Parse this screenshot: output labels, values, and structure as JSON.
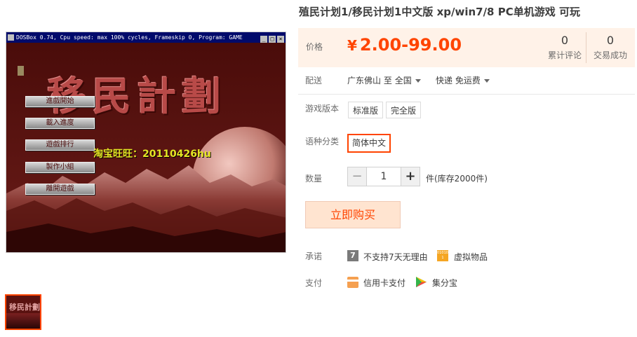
{
  "product": {
    "title": "殖民计划1/移民计划1中文版 xp/win7/8 PC单机游戏 可玩"
  },
  "gallery": {
    "window_title": "DOSBox 0.74, Cpu speed: max 100% cycles, Frameskip 0, Program: GAME",
    "game_title": "移民計劃",
    "menu": [
      "進戲開始",
      "載入進度",
      "遊戲排行",
      "製作小組",
      "離開遊戲"
    ],
    "overlay_text": "淘宝旺旺：20110426hu",
    "thumb_title": "移民計劃"
  },
  "price": {
    "label": "价格",
    "symbol": "¥",
    "value": "2.00-99.00",
    "review_count": "0",
    "review_label": "累计评论",
    "sales_count": "0",
    "sales_label": "交易成功"
  },
  "shipping": {
    "label": "配送",
    "from": "广东佛山",
    "to_word": "至",
    "to": "全国",
    "method": "快递 免运费"
  },
  "version": {
    "label": "游戏版本",
    "options": [
      "标准版",
      "完全版"
    ]
  },
  "language": {
    "label": "语种分类",
    "options": [
      "简体中文"
    ],
    "selected": "简体中文"
  },
  "quantity": {
    "label": "数量",
    "minus": "−",
    "value": "1",
    "plus": "+",
    "unit": "件(库存2000件)"
  },
  "buy_label": "立即购买",
  "promise": {
    "label": "承诺",
    "items": [
      "不支持7天无理由",
      "虚拟物品"
    ],
    "icon7_text": "7",
    "virtual_icon_text": "010101"
  },
  "payment": {
    "label": "支付",
    "items": [
      "信用卡支付",
      "集分宝"
    ]
  },
  "colors": {
    "accent": "#ff4400",
    "price_bg": "#fff2e8",
    "buy_bg": "#ffe4d0",
    "game_bg": "#5a1210"
  }
}
